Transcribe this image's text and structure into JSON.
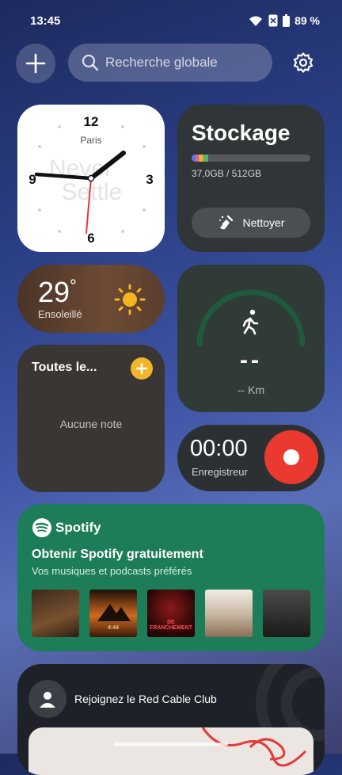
{
  "status_bar": {
    "time": "13:45",
    "battery": "89 %"
  },
  "search": {
    "placeholder": "Recherche globale"
  },
  "clock": {
    "numbers": [
      "12",
      "3",
      "6",
      "9"
    ],
    "city": "Paris",
    "watermark_line1": "Never",
    "watermark_line2": "Settle"
  },
  "storage": {
    "title": "Stockage",
    "usage": "37,0GB / 512GB",
    "used_fraction": 0.072,
    "clean_label": "Nettoyer"
  },
  "weather": {
    "temperature": "29",
    "degree": "°",
    "condition": "Ensoleillé"
  },
  "notes": {
    "title": "Toutes le...",
    "empty_text": "Aucune note"
  },
  "steps": {
    "value": "--",
    "unit": "-- Km"
  },
  "recorder": {
    "time": "00:00",
    "label": "Enregistreur"
  },
  "spotify": {
    "brand": "Spotify",
    "title": "Obtenir Spotify gratuitement",
    "subtitle": "Vos musiques et podcasts préférés",
    "albums": [
      {
        "label": "",
        "color": "#5b3a22"
      },
      {
        "label": "4:44",
        "color": "#c4521a"
      },
      {
        "label": "DE FRANCHEMENT",
        "color": "#3a1010"
      },
      {
        "label": "",
        "color": "#e9e2d8"
      },
      {
        "label": "",
        "color": "#2a2a2a"
      }
    ]
  },
  "club": {
    "text": "Rejoignez le Red Cable Club"
  }
}
